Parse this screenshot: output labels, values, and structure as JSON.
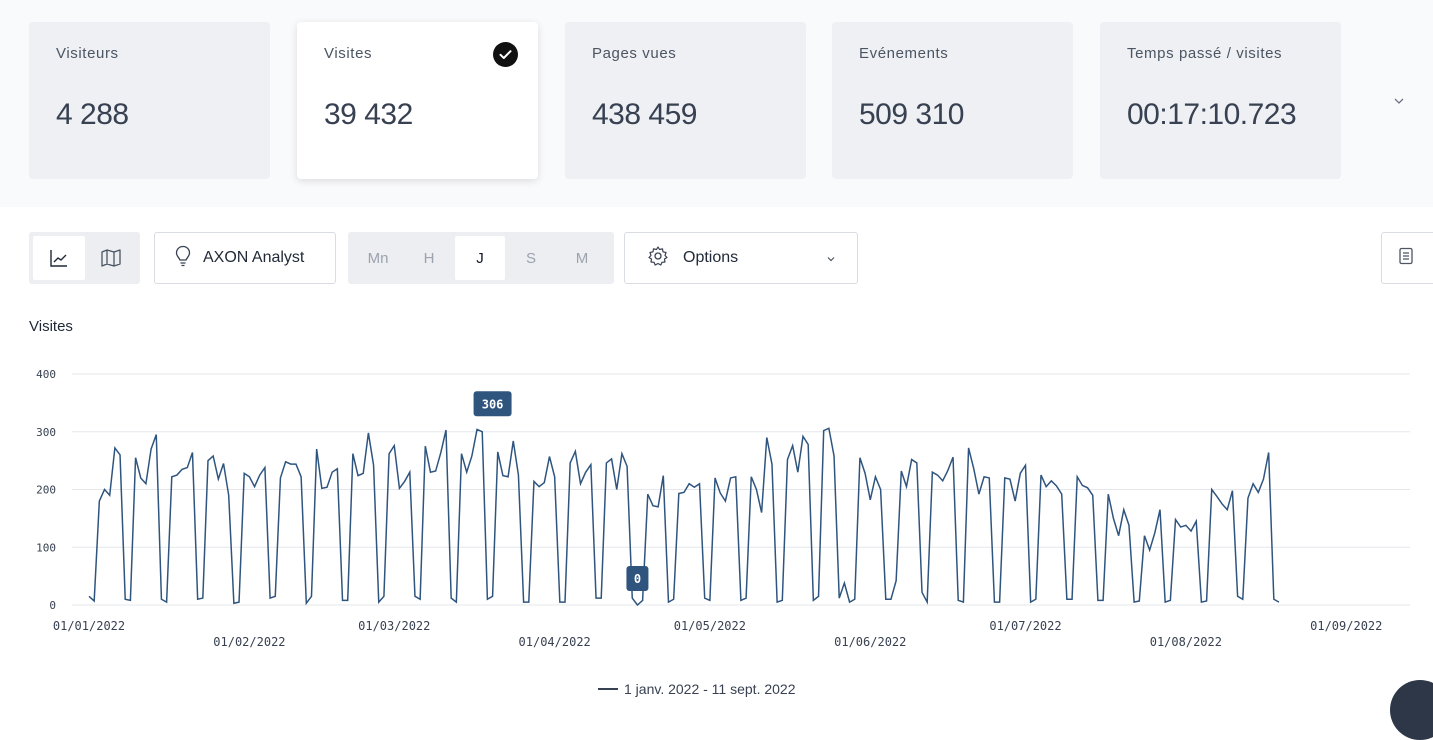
{
  "kpis": [
    {
      "label": "Visiteurs",
      "value": "4 288",
      "active": false
    },
    {
      "label": "Visites",
      "value": "39 432",
      "active": true
    },
    {
      "label": "Pages vues",
      "value": "438 459",
      "active": false
    },
    {
      "label": "Evénements",
      "value": "509 310",
      "active": false
    },
    {
      "label": "Temps passé / visites",
      "value": "00:17:10.723",
      "active": false
    }
  ],
  "toolbar": {
    "view_icons": [
      "line-chart-icon",
      "map-icon"
    ],
    "axon_label": "AXON Analyst",
    "granularity": [
      "Mn",
      "H",
      "J",
      "S",
      "M"
    ],
    "granularity_selected": "J",
    "options_label": "Options",
    "export_icon": "report-icon"
  },
  "chart_title": "Visites",
  "legend_label": "1 janv. 2022 - 11 sept. 2022",
  "colors": {
    "series": "#2f557f",
    "tooltip": "#2f557f",
    "grid": "#e5e7eb"
  },
  "chart_data": {
    "type": "line",
    "title": "Visites",
    "ylim": [
      0,
      400
    ],
    "yticks": [
      0,
      100,
      200,
      300,
      400
    ],
    "xticks": [
      "01/01/2022",
      "01/02/2022",
      "01/03/2022",
      "01/04/2022",
      "01/05/2022",
      "01/06/2022",
      "01/07/2022",
      "01/08/2022",
      "01/09/2022"
    ],
    "x_start": "2022-01-01",
    "x_end": "2022-09-11",
    "annotations": [
      {
        "label": "306",
        "date": "2022-03-20",
        "value": 306
      },
      {
        "label": "0",
        "date": "2022-04-17",
        "value": 0
      }
    ],
    "series": [
      {
        "name": "1 janv. 2022 - 11 sept. 2022",
        "values": [
          15,
          7,
          180,
          200,
          190,
          272,
          260,
          10,
          8,
          255,
          220,
          210,
          270,
          295,
          10,
          5,
          222,
          225,
          235,
          238,
          264,
          10,
          12,
          250,
          258,
          218,
          245,
          190,
          3,
          5,
          228,
          222,
          205,
          225,
          238,
          12,
          15,
          220,
          248,
          244,
          244,
          222,
          3,
          15,
          270,
          202,
          204,
          230,
          236,
          8,
          8,
          262,
          224,
          228,
          298,
          242,
          5,
          15,
          262,
          276,
          202,
          214,
          230,
          15,
          10,
          275,
          230,
          232,
          264,
          303,
          12,
          5,
          262,
          230,
          258,
          304,
          300,
          10,
          15,
          265,
          224,
          222,
          284,
          225,
          5,
          5,
          214,
          205,
          212,
          257,
          222,
          5,
          5,
          246,
          266,
          210,
          230,
          243,
          12,
          12,
          246,
          253,
          200,
          262,
          240,
          12,
          0,
          8,
          192,
          172,
          170,
          224,
          5,
          10,
          193,
          195,
          210,
          204,
          210,
          12,
          8,
          220,
          194,
          180,
          220,
          222,
          8,
          12,
          222,
          200,
          160,
          290,
          244,
          5,
          8,
          252,
          276,
          230,
          292,
          278,
          8,
          15,
          302,
          306,
          258,
          12,
          38,
          5,
          10,
          255,
          228,
          182,
          222,
          200,
          10,
          10,
          42,
          232,
          205,
          252,
          246,
          22,
          5,
          230,
          225,
          215,
          233,
          256,
          8,
          5,
          272,
          236,
          192,
          222,
          220,
          5,
          5,
          220,
          218,
          180,
          228,
          242,
          5,
          10,
          225,
          205,
          215,
          206,
          192,
          10,
          10,
          222,
          207,
          203,
          190,
          8,
          8,
          192,
          150,
          120,
          165,
          138,
          5,
          7,
          120,
          95,
          125,
          165,
          5,
          8,
          148,
          135,
          138,
          128,
          145,
          5,
          7,
          200,
          188,
          175,
          165,
          198,
          15,
          10,
          185,
          210,
          195,
          218,
          264,
          10,
          5
        ]
      }
    ]
  }
}
